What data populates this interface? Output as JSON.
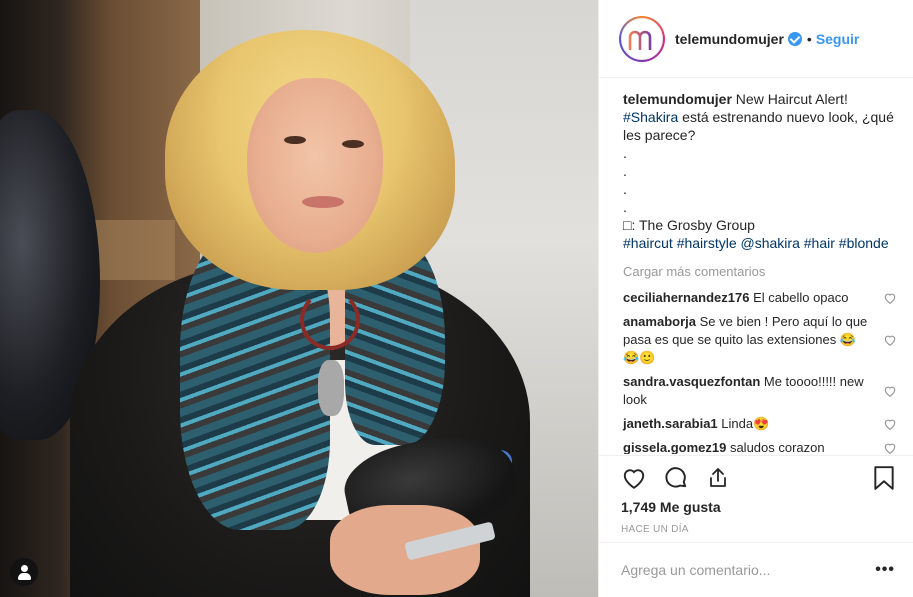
{
  "photo": {
    "alt": ""
  },
  "header": {
    "username": "telemundomujer",
    "dot": "•",
    "follow_label": "Seguir"
  },
  "caption": {
    "author": "telemundomujer",
    "line1": "New Haircut Alert!",
    "hashtag": "#Shakira",
    "line2": "está estrenando nuevo look, ¿qué les parece?",
    "dots": [
      ".",
      ".",
      ".",
      "."
    ],
    "credit": "□: The Grosby Group",
    "tags": [
      "#haircut",
      "#hairstyle",
      "@shakira",
      "#hair",
      "#blonde"
    ]
  },
  "load_more": "Cargar más comentarios",
  "comments": [
    {
      "user": "ceciliahernandez176",
      "text": "El cabello opaco"
    },
    {
      "user": "anamaborja",
      "text": "Se ve bien ! Pero aquí lo que pasa es que se quito las extensiones 😂😂🙂"
    },
    {
      "user": "sandra.vasquezfontan",
      "text": "Me toooo!!!!! new look"
    },
    {
      "user": "janeth.sarabia1",
      "text": "Linda😍"
    },
    {
      "user": "gissela.gomez19",
      "text": "saludos corazon"
    }
  ],
  "likes": "1,749 Me gusta",
  "timestamp": "HACE UN DÍA",
  "add_comment_placeholder": "Agrega un comentario...",
  "more_label": "•••",
  "colors": {
    "accent": "#3897f0",
    "hashtag": "#003569",
    "muted": "#999999"
  },
  "icons": [
    "user-tag-icon",
    "verified-badge-icon",
    "heart-icon",
    "comment-icon",
    "share-icon",
    "bookmark-icon"
  ]
}
